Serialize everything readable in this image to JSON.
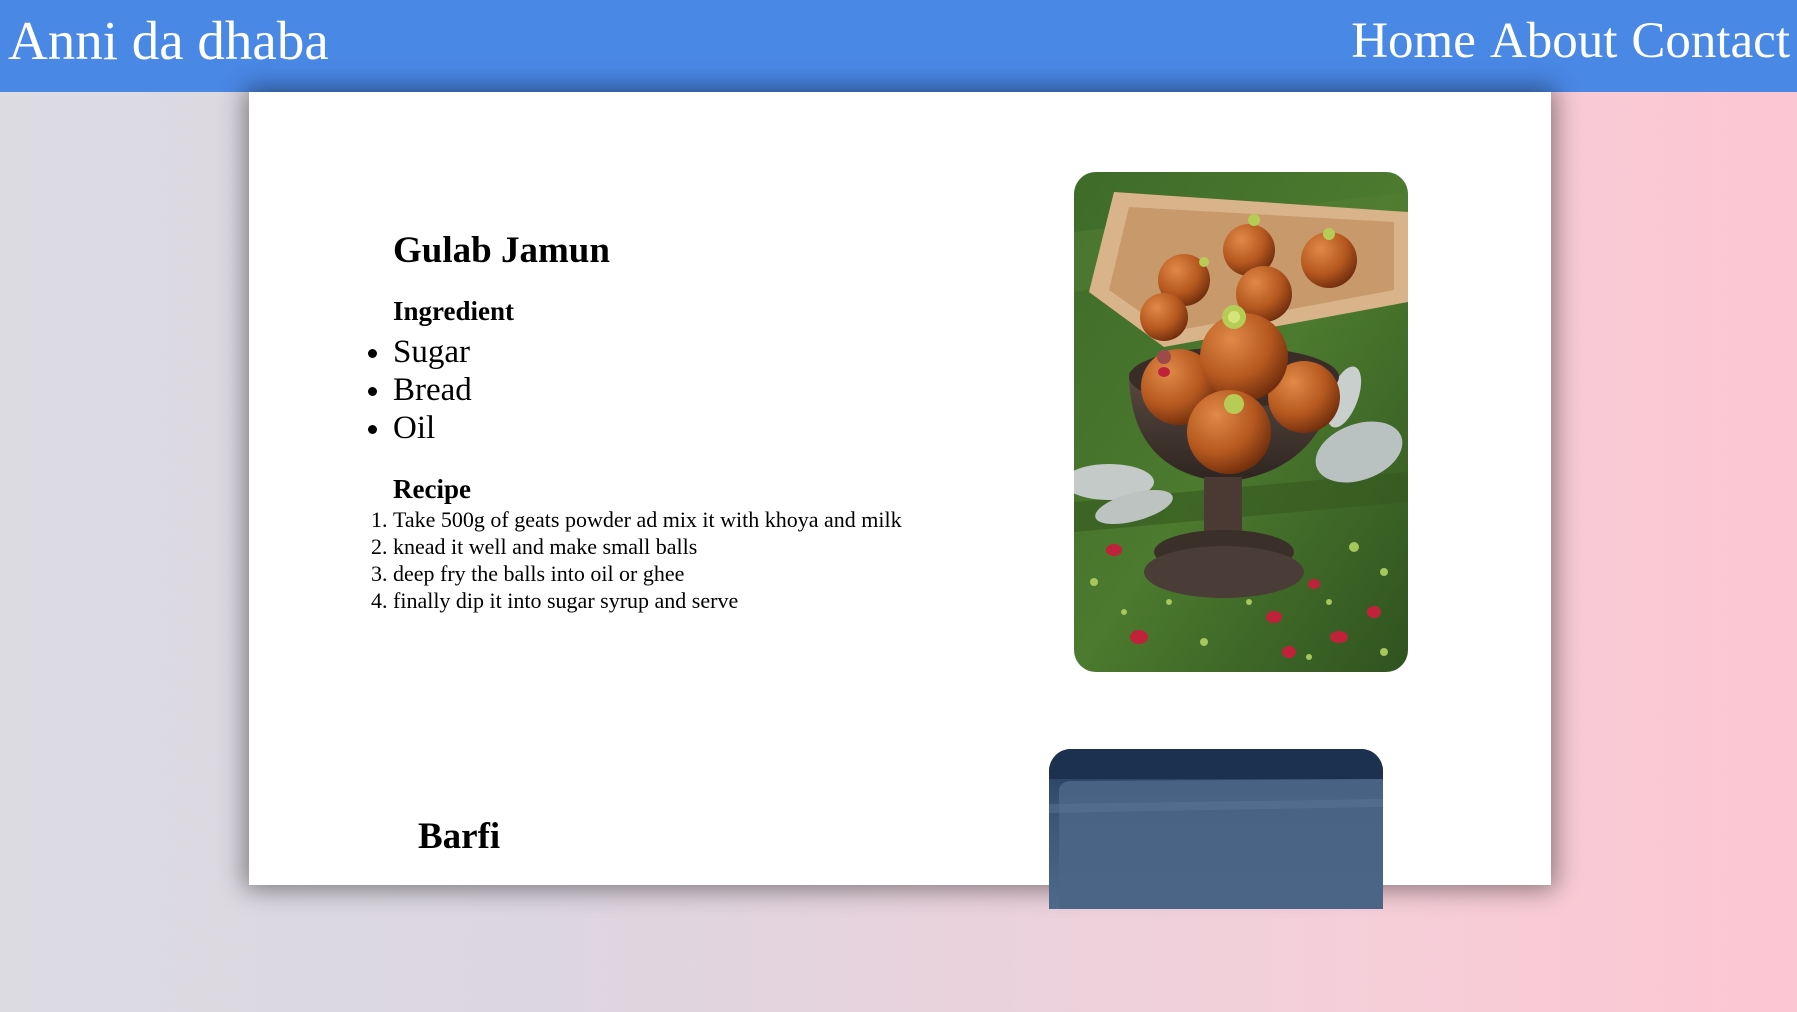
{
  "navbar": {
    "brand": "Anni da dhaba",
    "links": [
      "Home",
      "About",
      "Contact"
    ]
  },
  "recipes": [
    {
      "title": "Gulab Jamun",
      "ingredient_heading": "Ingredient",
      "ingredients": [
        "Sugar",
        "Bread",
        "Oil"
      ],
      "recipe_heading": "Recipe",
      "steps": [
        "Take 500g of geats powder ad mix it with khoya and milk",
        "knead it well and make small balls",
        "deep fry the balls into oil or ghee",
        "finally dip it into sugar syrup and serve"
      ],
      "image_icon": "gulab-jamun-photo"
    },
    {
      "title": "Barfi",
      "image_icon": "barfi-photo"
    }
  ],
  "colors": {
    "navbar": "#4a88e6",
    "nav_text": "#ffffff",
    "card": "#ffffff",
    "bg_left": "#dcdbe2",
    "bg_right": "#fcc6d2"
  }
}
